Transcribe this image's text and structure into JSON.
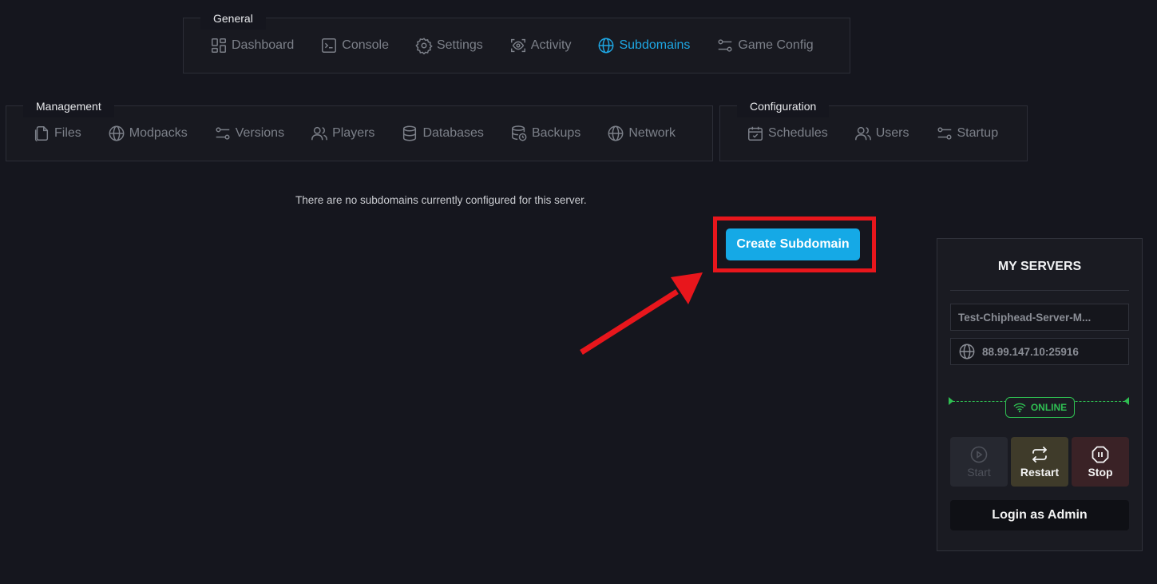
{
  "general": {
    "title": "General",
    "items": [
      {
        "label": "Dashboard",
        "icon": "dashboard-icon",
        "active": false
      },
      {
        "label": "Console",
        "icon": "terminal-icon",
        "active": false
      },
      {
        "label": "Settings",
        "icon": "gear-icon",
        "active": false
      },
      {
        "label": "Activity",
        "icon": "eye-icon",
        "active": false
      },
      {
        "label": "Subdomains",
        "icon": "globe-icon",
        "active": true
      },
      {
        "label": "Game Config",
        "icon": "sliders-icon",
        "active": false
      }
    ]
  },
  "management": {
    "title": "Management",
    "items": [
      {
        "label": "Files",
        "icon": "files-icon"
      },
      {
        "label": "Modpacks",
        "icon": "globe-icon"
      },
      {
        "label": "Versions",
        "icon": "sliders-icon"
      },
      {
        "label": "Players",
        "icon": "users-icon"
      },
      {
        "label": "Databases",
        "icon": "database-icon"
      },
      {
        "label": "Backups",
        "icon": "backup-icon"
      },
      {
        "label": "Network",
        "icon": "globe-icon"
      }
    ]
  },
  "configuration": {
    "title": "Configuration",
    "items": [
      {
        "label": "Schedules",
        "icon": "calendar-icon"
      },
      {
        "label": "Users",
        "icon": "users-icon"
      },
      {
        "label": "Startup",
        "icon": "sliders-icon"
      }
    ]
  },
  "main": {
    "empty_message": "There are no subdomains currently configured for this server.",
    "create_button": "Create Subdomain"
  },
  "colors": {
    "accent": "#15a9e6",
    "highlight": "#e8161c",
    "online": "#2fbf52"
  },
  "server_panel": {
    "title": "MY SERVERS",
    "server_name": "Test-Chiphead-Server-M...",
    "server_ip": "88.99.147.10:25916",
    "status": "ONLINE",
    "start_label": "Start",
    "restart_label": "Restart",
    "stop_label": "Stop",
    "admin_label": "Login as Admin"
  }
}
